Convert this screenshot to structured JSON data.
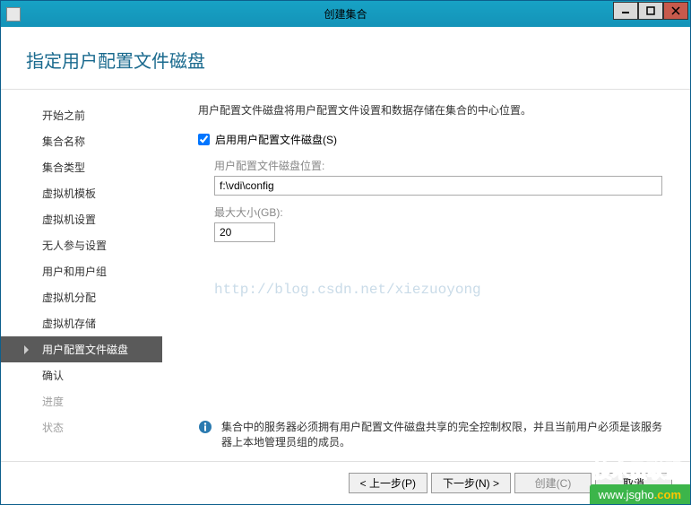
{
  "window": {
    "title": "创建集合"
  },
  "page": {
    "title": "指定用户配置文件磁盘"
  },
  "sidebar": {
    "items": [
      {
        "label": "开始之前"
      },
      {
        "label": "集合名称"
      },
      {
        "label": "集合类型"
      },
      {
        "label": "虚拟机模板"
      },
      {
        "label": "虚拟机设置"
      },
      {
        "label": "无人参与设置"
      },
      {
        "label": "用户和用户组"
      },
      {
        "label": "虚拟机分配"
      },
      {
        "label": "虚拟机存储"
      },
      {
        "label": "用户配置文件磁盘"
      },
      {
        "label": "确认"
      },
      {
        "label": "进度"
      },
      {
        "label": "状态"
      }
    ]
  },
  "main": {
    "intro": "用户配置文件磁盘将用户配置文件设置和数据存储在集合的中心位置。",
    "checkbox_label": "启用用户配置文件磁盘(S)",
    "location_label": "用户配置文件磁盘位置:",
    "location_value": "f:\\vdi\\config",
    "maxsize_label": "最大大小(GB):",
    "maxsize_value": "20",
    "watermark": "http://blog.csdn.net/xiezuoyong",
    "info_text": "集合中的服务器必须拥有用户配置文件磁盘共享的完全控制权限，并且当前用户必须是该服务器上本地管理员组的成员。"
  },
  "footer": {
    "prev": "< 上一步(P)",
    "next": "下一步(N) >",
    "create": "创建(C)",
    "cancel": "取消"
  },
  "brand": {
    "text": "技术员联盟",
    "url": "www.jsgho",
    "ext": ".com"
  }
}
